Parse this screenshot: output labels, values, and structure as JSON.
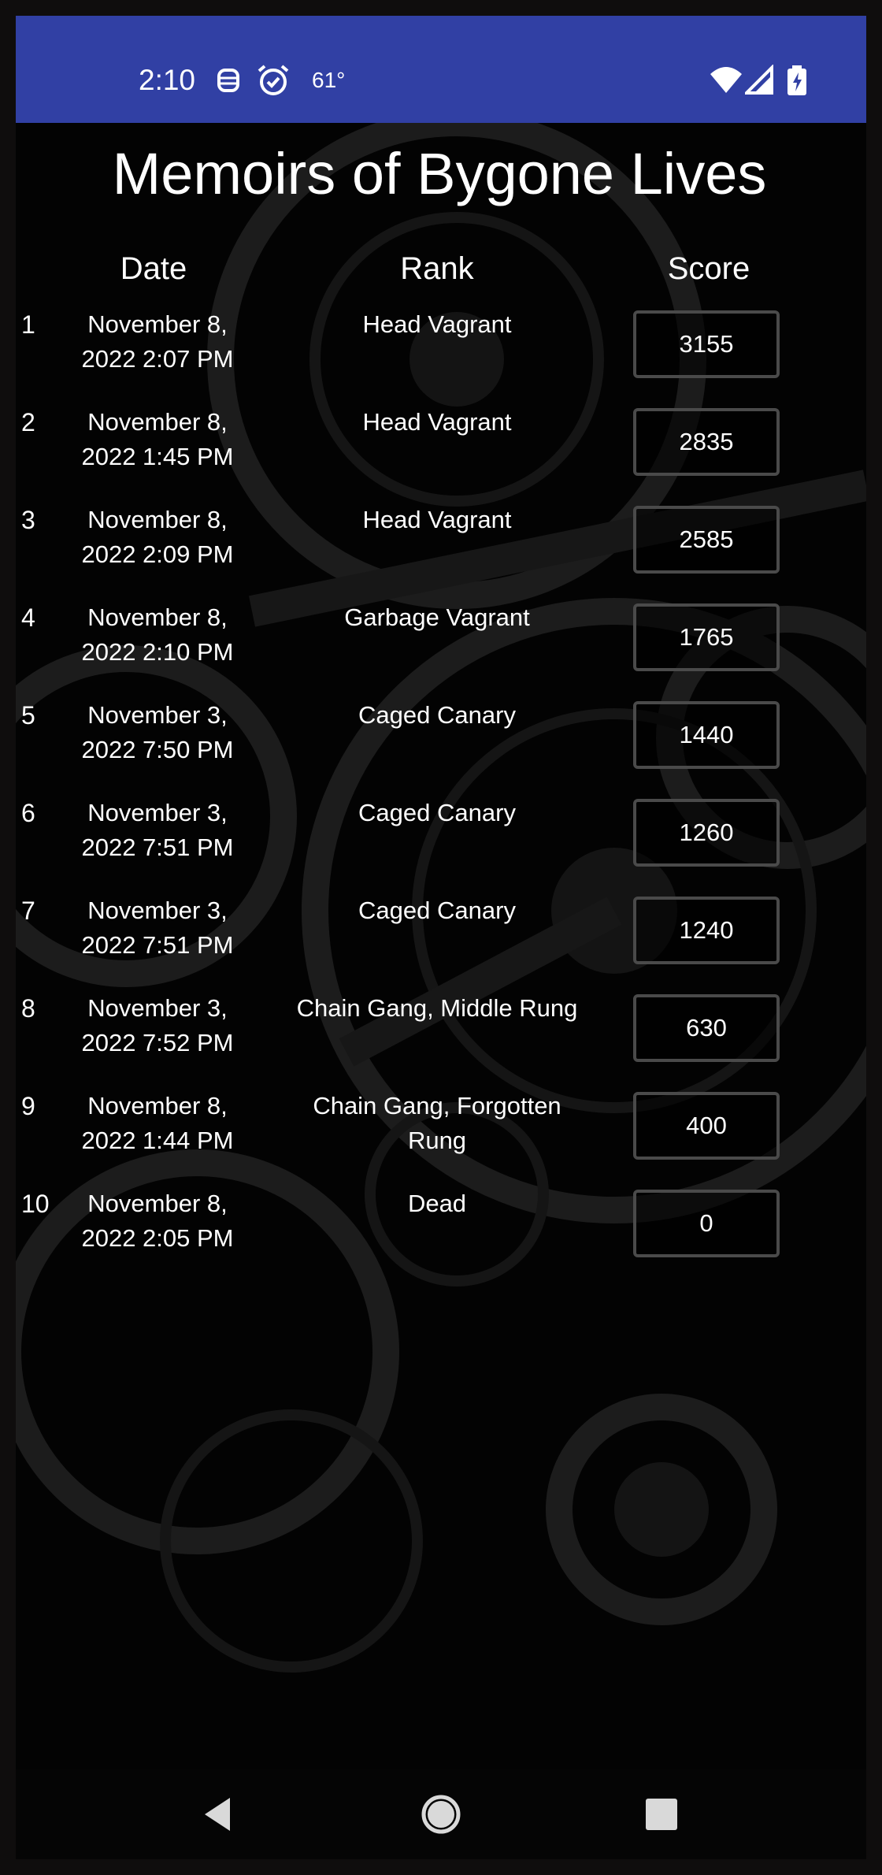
{
  "status_bar": {
    "time": "2:10",
    "temperature": "61°",
    "icons": [
      "android-debug-icon",
      "alarm-icon",
      "wifi-icon",
      "signal-icon",
      "battery-charging-icon"
    ]
  },
  "page": {
    "title": "Memoirs of Bygone Lives"
  },
  "table": {
    "headers": {
      "date": "Date",
      "rank": "Rank",
      "score": "Score"
    },
    "rows": [
      {
        "num": "1",
        "date": "November 8, 2022 2:07 PM",
        "rank": "Head Vagrant",
        "score": "3155"
      },
      {
        "num": "2",
        "date": "November 8, 2022 1:45 PM",
        "rank": "Head Vagrant",
        "score": "2835"
      },
      {
        "num": "3",
        "date": "November 8, 2022 2:09 PM",
        "rank": "Head Vagrant",
        "score": "2585"
      },
      {
        "num": "4",
        "date": "November 8, 2022 2:10 PM",
        "rank": "Garbage Vagrant",
        "score": "1765"
      },
      {
        "num": "5",
        "date": "November 3, 2022 7:50 PM",
        "rank": "Caged Canary",
        "score": "1440"
      },
      {
        "num": "6",
        "date": "November 3, 2022 7:51 PM",
        "rank": "Caged Canary",
        "score": "1260"
      },
      {
        "num": "7",
        "date": "November 3, 2022 7:51 PM",
        "rank": "Caged Canary",
        "score": "1240"
      },
      {
        "num": "8",
        "date": "November 3, 2022 7:52 PM",
        "rank": "Chain Gang, Middle Rung",
        "score": "630"
      },
      {
        "num": "9",
        "date": "November 8, 2022 1:44 PM",
        "rank": "Chain Gang, Forgotten Rung",
        "score": "400"
      },
      {
        "num": "10",
        "date": "November 8, 2022 2:05 PM",
        "rank": "Dead",
        "score": "0"
      }
    ]
  },
  "nav_bar": {
    "buttons": [
      "back-icon",
      "home-icon",
      "recents-icon"
    ]
  },
  "colors": {
    "status_bar": "#3140a4",
    "background": "#030303",
    "score_border": "#4a4a4a",
    "text": "#ffffff"
  }
}
